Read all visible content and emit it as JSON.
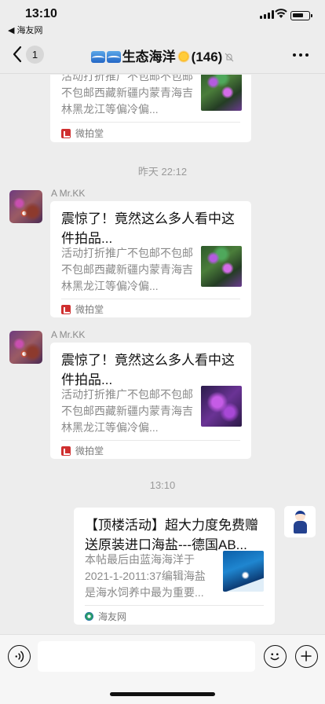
{
  "status_bar": {
    "time": "13:10",
    "back_app": "◀ 海友网"
  },
  "nav": {
    "back_count": "1",
    "title": "生态海洋",
    "member_count": "(146)"
  },
  "messages": {
    "card0": {
      "desc": "活动打折推广不包邮不包邮不包邮西藏新疆内蒙青海吉林黑龙江等偏冷偏...",
      "source": "微拍堂"
    },
    "time1": "昨天 22:12",
    "card1": {
      "sender": "A  Mr.KK",
      "title": "震惊了！竟然这么多人看中这件拍品...",
      "desc": "活动打折推广不包邮不包邮不包邮西藏新疆内蒙青海吉林黑龙江等偏冷偏...",
      "source": "微拍堂"
    },
    "card2": {
      "sender": "A  Mr.KK",
      "title": "震惊了！竟然这么多人看中这件拍品...",
      "desc": "活动打折推广不包邮不包邮不包邮西藏新疆内蒙青海吉林黑龙江等偏冷偏...",
      "source": "微拍堂"
    },
    "time2": "13:10",
    "card3": {
      "title": "【顶楼活动】超大力度免费赠送原装进口海盐---德国AB...",
      "desc": "本帖最后由蓝海海洋于2021-1-2011:37编辑海盐是海水饲养中最为重要...",
      "source": "海友网"
    }
  },
  "input_bar": {
    "placeholder": ""
  }
}
